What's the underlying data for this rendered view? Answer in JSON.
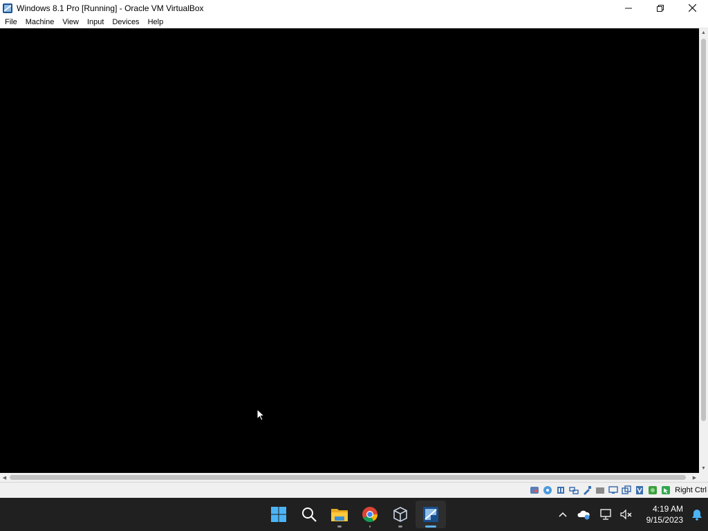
{
  "window": {
    "title": "Windows 8.1 Pro [Running] - Oracle VM VirtualBox",
    "app_icon": "virtualbox-icon",
    "controls": {
      "minimize": "minimize-icon",
      "maximize": "restore-icon",
      "close": "close-icon"
    }
  },
  "menubar": {
    "items": [
      {
        "label": "File"
      },
      {
        "label": "Machine"
      },
      {
        "label": "View"
      },
      {
        "label": "Input"
      },
      {
        "label": "Devices"
      },
      {
        "label": "Help"
      }
    ]
  },
  "vm": {
    "screen_color": "#000000"
  },
  "statusbar": {
    "icons": [
      "hard-disk-icon",
      "optical-drive-icon",
      "audio-icon",
      "network-icon",
      "usb-icon",
      "shared-folders-icon",
      "display-icon",
      "video-capture-icon",
      "virtualization-icon",
      "cpu-icon",
      "mouse-integration-icon",
      "keyboard-icon"
    ],
    "host_key": "Right Ctrl"
  },
  "taskbar": {
    "apps": [
      {
        "name": "start-icon",
        "active": false
      },
      {
        "name": "search-icon",
        "active": false
      },
      {
        "name": "file-explorer-icon",
        "active": false
      },
      {
        "name": "chrome-icon",
        "active": false
      },
      {
        "name": "virtualbox-manager-icon",
        "active": false
      },
      {
        "name": "virtualbox-vm-icon",
        "active": true
      }
    ],
    "tray": {
      "overflow_icon": "chevron-up-icon",
      "icons": [
        "onedrive-icon",
        "network-icon",
        "volume-muted-icon"
      ],
      "time": "4:19 AM",
      "date": "9/15/2023",
      "notification_icon": "bell-icon"
    }
  },
  "colors": {
    "accent": "#5cb4f5",
    "taskbar_bg": "#202020",
    "vm_bg": "#000000"
  }
}
